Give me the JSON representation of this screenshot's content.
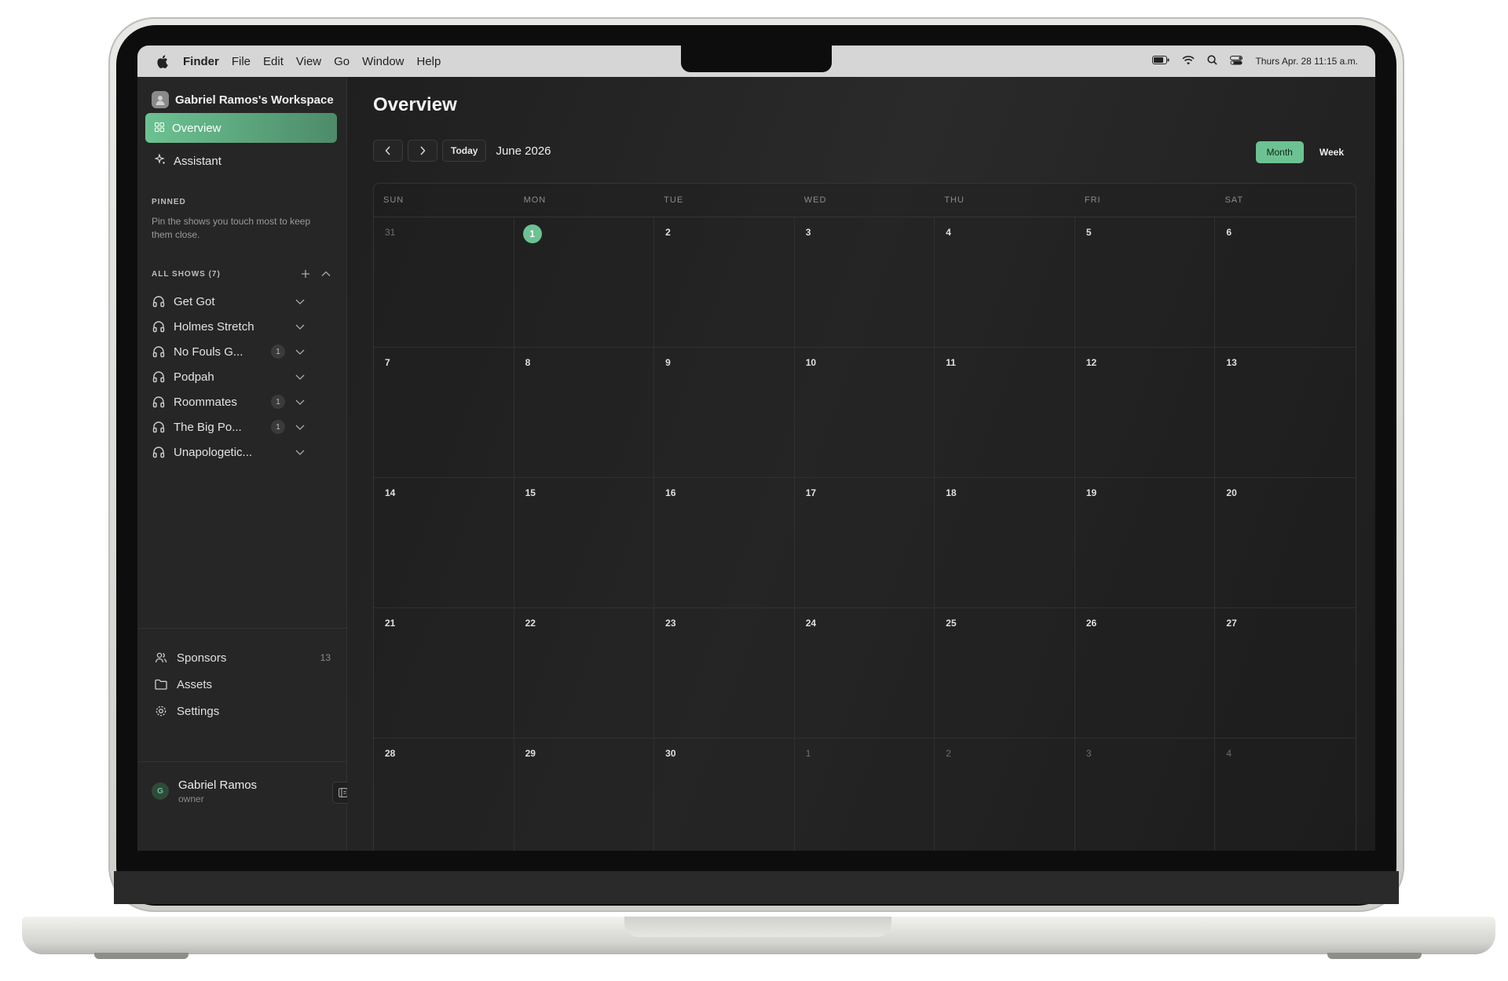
{
  "menubar": {
    "app_name": "Finder",
    "items": [
      "File",
      "Edit",
      "View",
      "Go",
      "Window",
      "Help"
    ],
    "datetime": "Thurs Apr. 28 11:15 a.m."
  },
  "sidebar": {
    "workspace": "Gabriel Ramos's Workspace",
    "nav": [
      {
        "label": "Overview",
        "icon": "grid-icon",
        "active": true
      },
      {
        "label": "Assistant",
        "icon": "sparkle-icon",
        "active": false
      }
    ],
    "pinned_label": "PINNED",
    "pinned_hint": "Pin the shows you touch most to keep them close.",
    "shows_label": "ALL SHOWS (7)",
    "shows": [
      {
        "name": "Get Got",
        "badge": ""
      },
      {
        "name": "Holmes Stretch",
        "badge": ""
      },
      {
        "name": "No Fouls G...",
        "badge": "1"
      },
      {
        "name": "Podpah",
        "badge": ""
      },
      {
        "name": "Roommates",
        "badge": "1"
      },
      {
        "name": "The Big Po...",
        "badge": "1"
      },
      {
        "name": "Unapologetic...",
        "badge": ""
      }
    ],
    "bottom": [
      {
        "label": "Sponsors",
        "icon": "users-icon",
        "count": "13"
      },
      {
        "label": "Assets",
        "icon": "folder-icon",
        "count": ""
      },
      {
        "label": "Settings",
        "icon": "gear-icon",
        "count": ""
      }
    ],
    "user": {
      "initial": "G",
      "name": "Gabriel Ramos",
      "role": "owner"
    }
  },
  "main": {
    "title": "Overview",
    "today_label": "Today",
    "month_label": "June 2026",
    "views": [
      {
        "label": "Month",
        "active": true
      },
      {
        "label": "Week",
        "active": false
      }
    ],
    "weekdays": [
      "SUN",
      "MON",
      "TUE",
      "WED",
      "THU",
      "FRI",
      "SAT"
    ],
    "days": [
      {
        "n": "31",
        "muted": true
      },
      {
        "n": "1",
        "today": true
      },
      {
        "n": "2"
      },
      {
        "n": "3"
      },
      {
        "n": "4"
      },
      {
        "n": "5"
      },
      {
        "n": "6"
      },
      {
        "n": "7"
      },
      {
        "n": "8"
      },
      {
        "n": "9"
      },
      {
        "n": "10"
      },
      {
        "n": "11"
      },
      {
        "n": "12"
      },
      {
        "n": "13"
      },
      {
        "n": "14"
      },
      {
        "n": "15"
      },
      {
        "n": "16"
      },
      {
        "n": "17"
      },
      {
        "n": "18"
      },
      {
        "n": "19"
      },
      {
        "n": "20"
      },
      {
        "n": "21"
      },
      {
        "n": "22"
      },
      {
        "n": "23"
      },
      {
        "n": "24"
      },
      {
        "n": "25"
      },
      {
        "n": "26"
      },
      {
        "n": "27"
      },
      {
        "n": "28"
      },
      {
        "n": "29"
      },
      {
        "n": "30"
      },
      {
        "n": "1",
        "muted": true
      },
      {
        "n": "2",
        "muted": true
      },
      {
        "n": "3",
        "muted": true
      },
      {
        "n": "4",
        "muted": true
      }
    ]
  },
  "colors": {
    "accent": "#6cc292",
    "sidebar_bg": "#262626",
    "main_bg": "#1f1f1f"
  }
}
